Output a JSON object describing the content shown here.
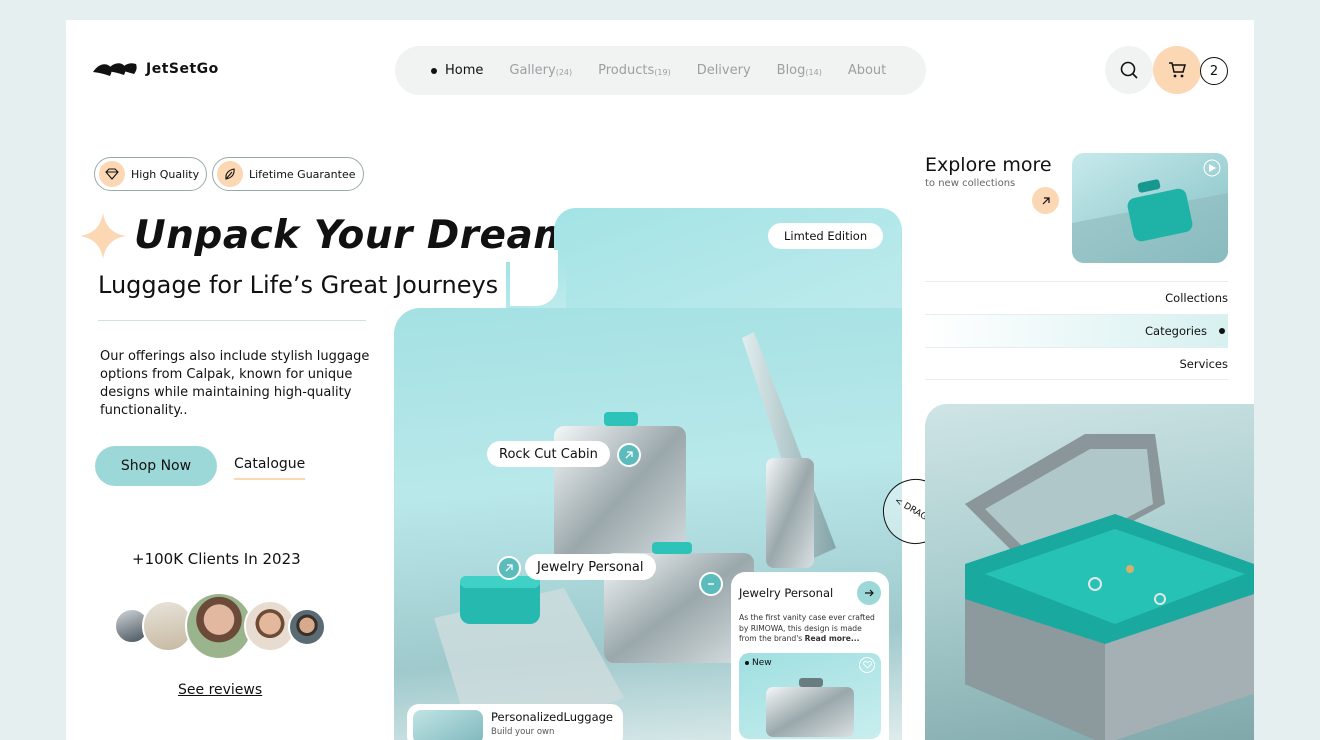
{
  "brand": {
    "name": "JetSetGo"
  },
  "nav": {
    "items": [
      {
        "label": "Home",
        "count": ""
      },
      {
        "label": "Gallery",
        "count": "(24)"
      },
      {
        "label": "Products",
        "count": "(19)"
      },
      {
        "label": "Delivery",
        "count": ""
      },
      {
        "label": "Blog",
        "count": "(14)"
      },
      {
        "label": "About",
        "count": ""
      }
    ],
    "active": "Home"
  },
  "cart": {
    "count": "2"
  },
  "badges": {
    "quality": "High Quality",
    "guarantee": "Lifetime Guarantee"
  },
  "hero": {
    "headline": "Unpack Your Dreams",
    "subheadline": "Luggage for Life’s Great Journeys",
    "description": "Our offerings also include stylish luggage options from Calpak, known for unique designs while maintaining high-quality functionality..",
    "shop_label": "Shop Now",
    "catalogue_label": "Catalogue",
    "limited_label": "Limted Edition",
    "hotspot_rock": "Rock Cut Cabin",
    "hotspot_jewelry": "Jewelry Personal",
    "drag_label": "< DRAG >"
  },
  "jewelry_card": {
    "title": "Jewelry Personal",
    "text": "As the first vanity case ever crafted by RIMOWA, this design is made from the brand's",
    "read_more": "Read more...",
    "new_label": "New"
  },
  "personalized_card": {
    "title": "PersonalizedLuggage",
    "subtitle": "Build your own"
  },
  "social": {
    "clients": "+100K Clients In 2023",
    "reviews_label": "See reviews"
  },
  "explore": {
    "title": "Explore more",
    "subtitle": "to new collections"
  },
  "side_menu": {
    "items": [
      "Collections",
      "Categories",
      "Services"
    ],
    "active": "Categories"
  },
  "colors": {
    "accent_teal": "#9dd8d8",
    "accent_peach": "#fcd7b3",
    "dark": "#111111"
  }
}
